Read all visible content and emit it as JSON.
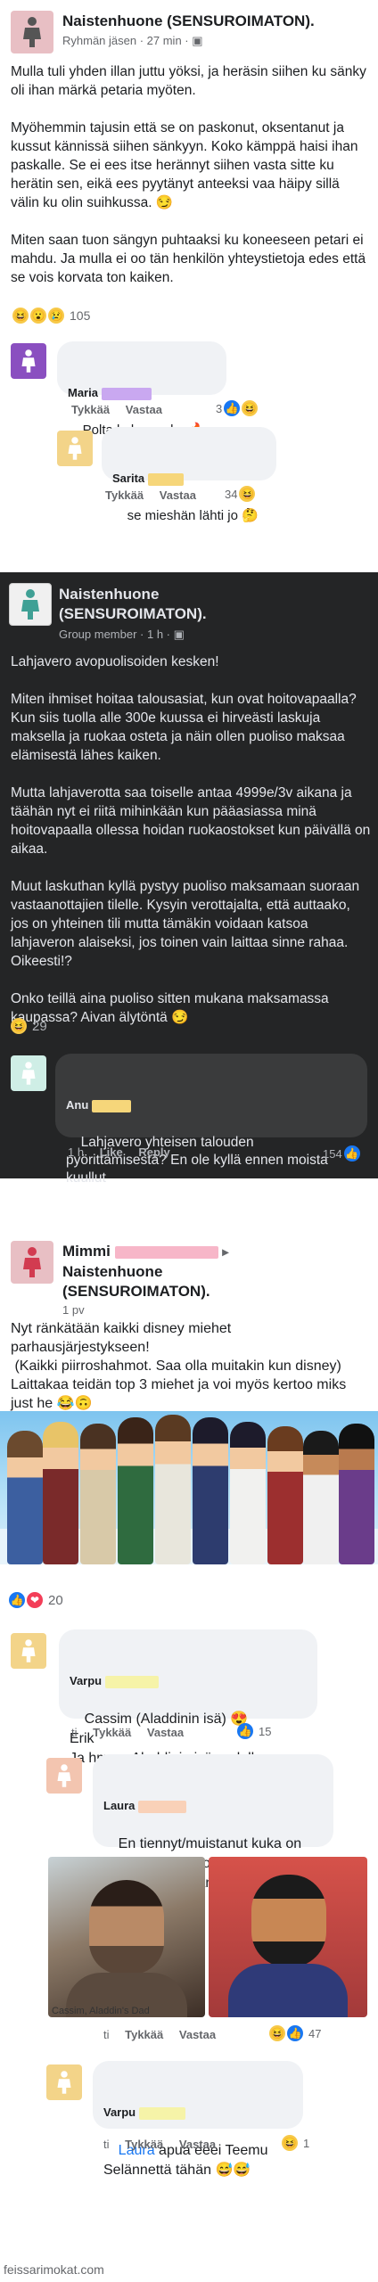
{
  "post1": {
    "group": "Naistenhuone (SENSUROIMATON).",
    "meta": "Ryhmän jäsen · 27 min · ",
    "body": "Mulla tuli yhden illan juttu yöksi, ja heräsin siihen ku sänky oli ihan märkä petaria myöten.\n\nMyöhemmin tajusin että se on paskonut, oksentanut ja kussut kännissä siihen sänkyyn. Koko kämppä haisi ihan paskalle. Se ei ees itse herännyt siihen vasta sitte ku herätin sen, eikä ees pyytänyt anteeksi vaa häipy sillä välin ku olin suihkussa. 😏\n\nMiten saan tuon sängyn puhtaaksi ku koneeseen petari ei mahdu. Ja mulla ei oo tän henkilön yhteystietoja edes että se vois korvata ton kaiken.",
    "reactions_count": "105",
    "comments": [
      {
        "name": "Maria",
        "text": "Polta koko paska 🔥",
        "actions": [
          "Tykkää",
          "Vastaa"
        ],
        "count": "3"
      },
      {
        "name": "Sarita",
        "text": "se mieshän lähti jo 🤔",
        "actions": [
          "Tykkää",
          "Vastaa"
        ],
        "count": "34"
      }
    ]
  },
  "post2": {
    "group": "Naistenhuone\n(SENSUROIMATON).",
    "meta": "Group member · 1 h · ",
    "body": "Lahjavero avopuolisoiden kesken!\n\nMiten ihmiset hoitaa talousasiat, kun ovat hoitovapaalla? Kun siis tuolla alle 300e kuussa ei hirveästi laskuja maksella ja ruokaa osteta ja näin ollen puoliso maksaa elämisestä lähes kaiken.\n\nMutta lahjaverotta saa toiselle antaa 4999e/3v aikana ja täähän nyt ei riitä mihinkään kun pääasiassa minä hoitovapaalla ollessa hoidan ruokaostokset kun päivällä on aikaa.\n\nMuut laskuthan kyllä pystyy puoliso maksamaan suoraan vastaanottajien tilelle. Kysyin verottajalta, että auttaako, jos on yhteinen tili mutta tämäkin voidaan katsoa lahjaveron alaiseksi, jos toinen vain laittaa sinne rahaa. Oikeesti!?\n\nOnko teillä aina puoliso sitten mukana maksamassa kaupassa? Aivan älytöntä 😏",
    "reactions_count": "29",
    "comment": {
      "name": "Anu",
      "text": "Lahjavero yhteisen talouden pyörittämisestä? En ole kyllä ennen moista kuullut",
      "time": "1 h",
      "actions": [
        "Like",
        "Reply"
      ],
      "count": "154"
    }
  },
  "post3": {
    "name": "Mimmi",
    "group": "Naistenhuone\n(SENSUROIMATON).",
    "meta": "1 pv",
    "body": "Nyt ränkätään kaikki disney miehet parhausjärjestykseen!\n (Kaikki piirroshahmot. Saa olla muitakin kun disney)\nLaittakaa teidän top 3 miehet ja voi myös kertoo miks just he 😂🙃",
    "reactions_count": "20",
    "comments": [
      {
        "name": "Varpu",
        "text": "Cassim (Aladdinin isä) 😍\nErik\nJa hmm.. Aladdinin isä uudelleen",
        "actions": [
          "ti",
          "Tykkää",
          "Vastaa"
        ],
        "count": "15"
      },
      {
        "name": "Laura",
        "text": "En tiennyt/muistanut kuka on Aladdinin iskä, joten googletin. Siis Teemu Selänne?",
        "actions": [
          "ti",
          "Tykkää",
          "Vastaa"
        ],
        "count": "47"
      },
      {
        "name": "Varpu",
        "text_prefix": "Laura",
        "text": " apua eeei Teemu Selännettä tähän 😅😅",
        "actions": [
          "ti",
          "Tykkää",
          "Vastaa"
        ],
        "count": "1"
      }
    ],
    "photo_caption": "Cassim, Aladdin's Dad"
  },
  "footer": "feissarimokat.com",
  "icons": {
    "avatar": "person-icon",
    "globe": "group-privacy-icon"
  },
  "colors": {
    "dark_bg": "#242526",
    "link_blue": "#1877f2",
    "redact_purple": "#c9a8f0",
    "redact_yellow": "#f6d67a",
    "redact_pink": "#f7b6c8",
    "redact_peach": "#f9d1b8"
  }
}
